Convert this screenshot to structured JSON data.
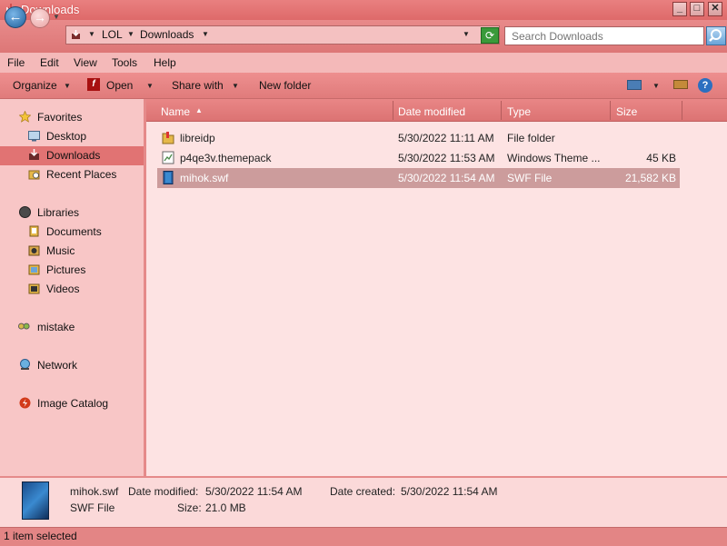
{
  "window": {
    "title": "Downloads"
  },
  "nav": {
    "address": [
      "LOL",
      "Downloads"
    ],
    "search_placeholder": "Search Downloads"
  },
  "menu": [
    "File",
    "Edit",
    "View",
    "Tools",
    "Help"
  ],
  "toolbar": {
    "organize": "Organize",
    "open": "Open",
    "share_with": "Share with",
    "new_folder": "New folder"
  },
  "sidebar": {
    "favorites": {
      "label": "Favorites",
      "items": [
        "Desktop",
        "Downloads",
        "Recent Places"
      ]
    },
    "libraries": {
      "label": "Libraries",
      "items": [
        "Documents",
        "Music",
        "Pictures",
        "Videos"
      ]
    },
    "mistake": "mistake",
    "network": "Network",
    "image_catalog": "Image Catalog",
    "selected": "Downloads"
  },
  "columns": [
    "Name",
    "Date modified",
    "Type",
    "Size"
  ],
  "files": [
    {
      "name": "libreidp",
      "modified": "5/30/2022 11:11 AM",
      "type": "File folder",
      "size": ""
    },
    {
      "name": "p4qe3v.themepack",
      "modified": "5/30/2022 11:53 AM",
      "type": "Windows Theme ...",
      "size": "45 KB"
    },
    {
      "name": "mihok.swf",
      "modified": "5/30/2022 11:54 AM",
      "type": "SWF File",
      "size": "21,582 KB"
    }
  ],
  "details": {
    "name": "mihok.swf",
    "type": "SWF File",
    "modified_label": "Date modified:",
    "modified": "5/30/2022 11:54 AM",
    "created_label": "Date created:",
    "created": "5/30/2022 11:54 AM",
    "size_label": "Size:",
    "size": "21.0 MB"
  },
  "status": "1 item selected",
  "colors": {
    "accent": "#de6a6a",
    "selection": "#cc9c9c",
    "background": "#fde3e3"
  }
}
